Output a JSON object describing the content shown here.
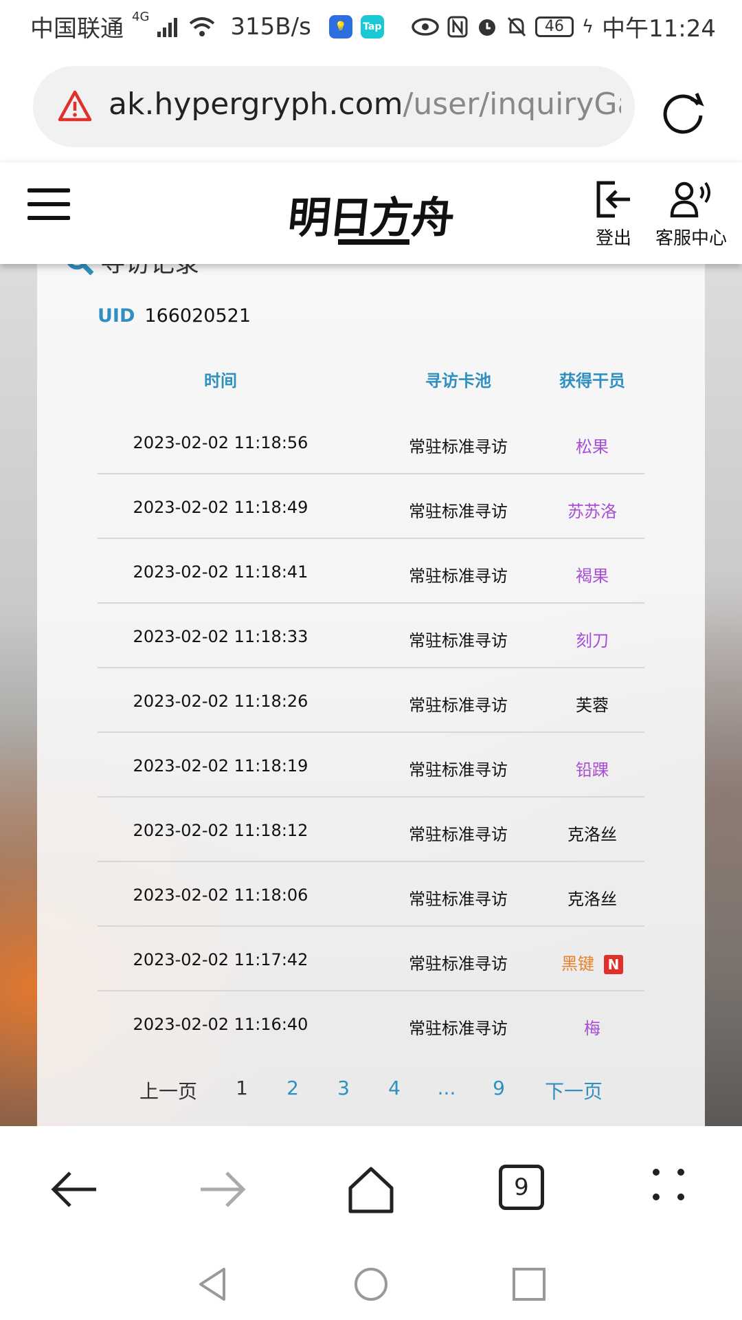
{
  "status_bar": {
    "carrier": "中国联通",
    "network": "4G",
    "speed": "315B/s",
    "app_badge_1": "lightbulb-icon",
    "app_badge_2": "Tap",
    "battery": "46",
    "time": "中午11:24"
  },
  "url_bar": {
    "domain": "ak.hypergryph.com",
    "path": "/user/inquiryGa"
  },
  "site_header": {
    "logo_text": "明日方舟",
    "logout_label": "登出",
    "service_label": "客服中心"
  },
  "section": {
    "title": "寻访记录"
  },
  "uid": {
    "label": "UID",
    "value": "166020521"
  },
  "table": {
    "headers": [
      "时间",
      "寻访卡池",
      "获得干员"
    ],
    "rows": [
      {
        "time": "2023-02-02 11:18:56",
        "pool": "常驻标准寻访",
        "operator": "松果",
        "color": "#a64ed6"
      },
      {
        "time": "2023-02-02 11:18:49",
        "pool": "常驻标准寻访",
        "operator": "苏苏洛",
        "color": "#a64ed6"
      },
      {
        "time": "2023-02-02 11:18:41",
        "pool": "常驻标准寻访",
        "operator": "褐果",
        "color": "#a64ed6"
      },
      {
        "time": "2023-02-02 11:18:33",
        "pool": "常驻标准寻访",
        "operator": "刻刀",
        "color": "#a64ed6"
      },
      {
        "time": "2023-02-02 11:18:26",
        "pool": "常驻标准寻访",
        "operator": "芙蓉",
        "color": "#111111"
      },
      {
        "time": "2023-02-02 11:18:19",
        "pool": "常驻标准寻访",
        "operator": "铅踝",
        "color": "#a64ed6"
      },
      {
        "time": "2023-02-02 11:18:12",
        "pool": "常驻标准寻访",
        "operator": "克洛丝",
        "color": "#111111"
      },
      {
        "time": "2023-02-02 11:18:06",
        "pool": "常驻标准寻访",
        "operator": "克洛丝",
        "color": "#111111"
      },
      {
        "time": "2023-02-02 11:17:42",
        "pool": "常驻标准寻访",
        "operator": "黑键",
        "color": "#e8812a",
        "badge": "N"
      },
      {
        "time": "2023-02-02 11:16:40",
        "pool": "常驻标准寻访",
        "operator": "梅",
        "color": "#a64ed6"
      }
    ]
  },
  "pagination": {
    "prev": "上一页",
    "pages": [
      "1",
      "2",
      "3",
      "4",
      "...",
      "9"
    ],
    "current": "1",
    "next": "下一页"
  },
  "browser_bar": {
    "tab_count": "9"
  },
  "colors": {
    "accent": "#2f8fc0",
    "purple_rarity": "#a64ed6",
    "orange_rarity": "#e8812a",
    "new_badge": "#e0302a"
  }
}
